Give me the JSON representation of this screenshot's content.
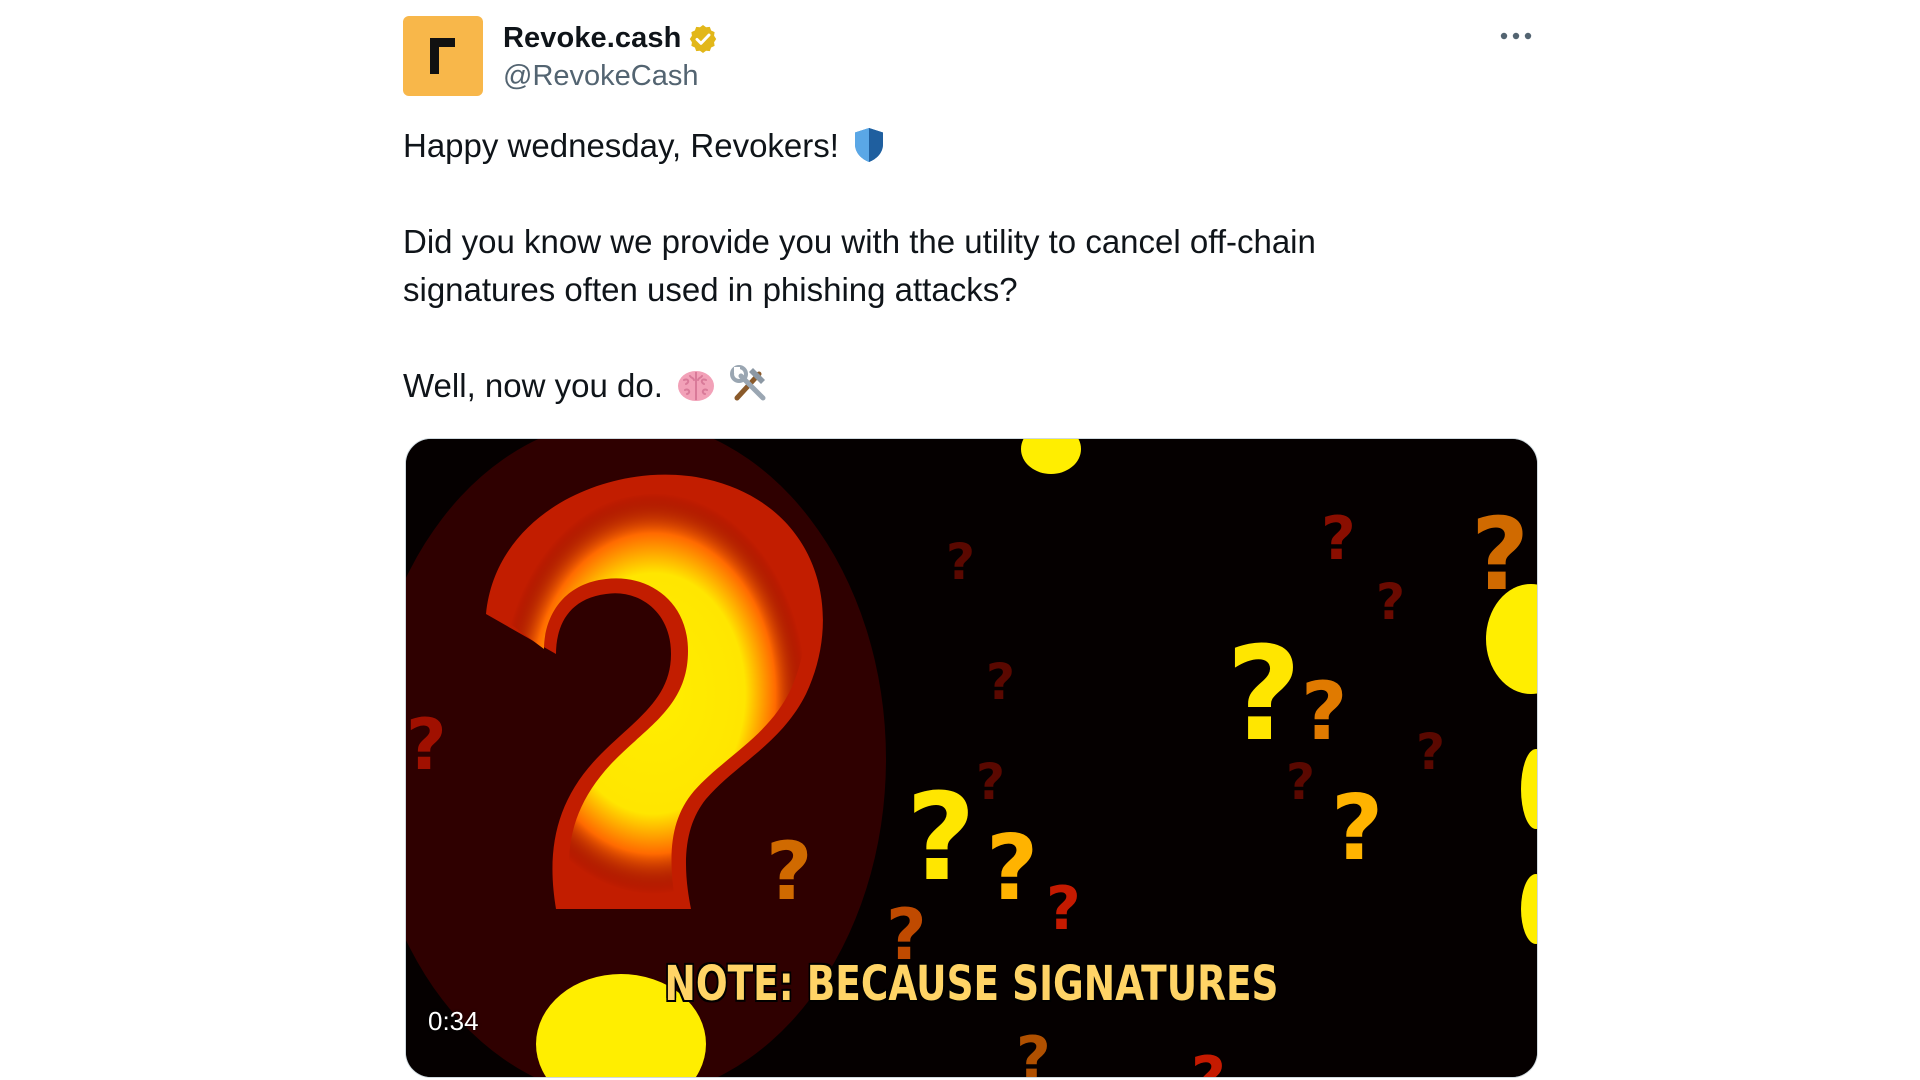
{
  "tweet": {
    "author": {
      "display_name": "Revoke.cash",
      "handle": "@RevokeCash",
      "verified": true,
      "avatar_color": "#f8b74a",
      "avatar_icon": "revoke-logo-icon"
    },
    "more_icon": "more-horizontal-icon",
    "text": {
      "line1": "Happy wednesday, Revokers!",
      "line1_emoji": "shield-emoji-icon",
      "line2": "Did you know we provide you with the utility to cancel off-chain",
      "line3": "signatures often used in phishing attacks?",
      "line4": "Well, now you do.",
      "line4_emojis": [
        "brain-emoji-icon",
        "hammer-and-wrench-emoji-icon"
      ]
    },
    "media": {
      "type": "video",
      "caption": "NOTE: BECAUSE SIGNATURES",
      "duration": "0:34",
      "accent_color": "#ffea00"
    }
  }
}
